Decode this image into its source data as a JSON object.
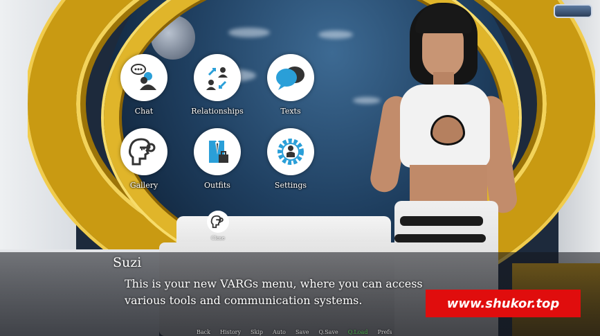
{
  "menu": {
    "items": [
      {
        "label": "Chat",
        "icon": "chat-person-icon"
      },
      {
        "label": "Relationships",
        "icon": "relationships-icon"
      },
      {
        "label": "Texts",
        "icon": "speech-bubbles-icon"
      },
      {
        "label": "Gallery",
        "icon": "head-key-icon"
      },
      {
        "label": "Outfits",
        "icon": "outfit-suit-icon"
      },
      {
        "label": "Settings",
        "icon": "gear-person-icon"
      }
    ],
    "close": {
      "label": "Close",
      "icon": "head-key-icon"
    }
  },
  "dialogue": {
    "speaker": "Suzi",
    "line1": "This is your new VARGs menu, where you can access",
    "line2": "various tools and communication systems."
  },
  "watermark": {
    "text": "www.shukor.top"
  },
  "quick_menu": {
    "items": [
      "Back",
      "History",
      "Skip",
      "Auto",
      "Save",
      "Q.Save",
      "Q.Load",
      "Prefs"
    ],
    "active": "Q.Load",
    "active_color": "#4fb04f"
  }
}
